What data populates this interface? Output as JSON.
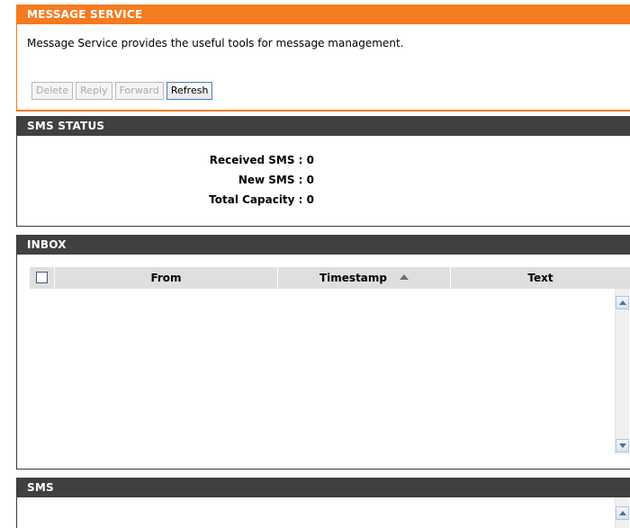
{
  "message_service": {
    "title": "MESSAGE SERVICE",
    "description": "Message Service provides the useful tools for message management.",
    "buttons": {
      "delete": "Delete",
      "reply": "Reply",
      "forward": "Forward",
      "refresh": "Refresh"
    }
  },
  "sms_status": {
    "title": "SMS STATUS",
    "rows": [
      {
        "label": "Received SMS : 0"
      },
      {
        "label": "New SMS : 0"
      },
      {
        "label": "Total Capacity : 0"
      }
    ]
  },
  "inbox": {
    "title": "INBOX",
    "columns": {
      "from": "From",
      "timestamp": "Timestamp",
      "text": "Text"
    },
    "sort_direction": "ascending",
    "rows": []
  },
  "sms": {
    "title": "SMS"
  },
  "colors": {
    "accent_orange": "#f47b20",
    "header_dark": "#404040",
    "column_header_bg": "#dfdfdf"
  }
}
